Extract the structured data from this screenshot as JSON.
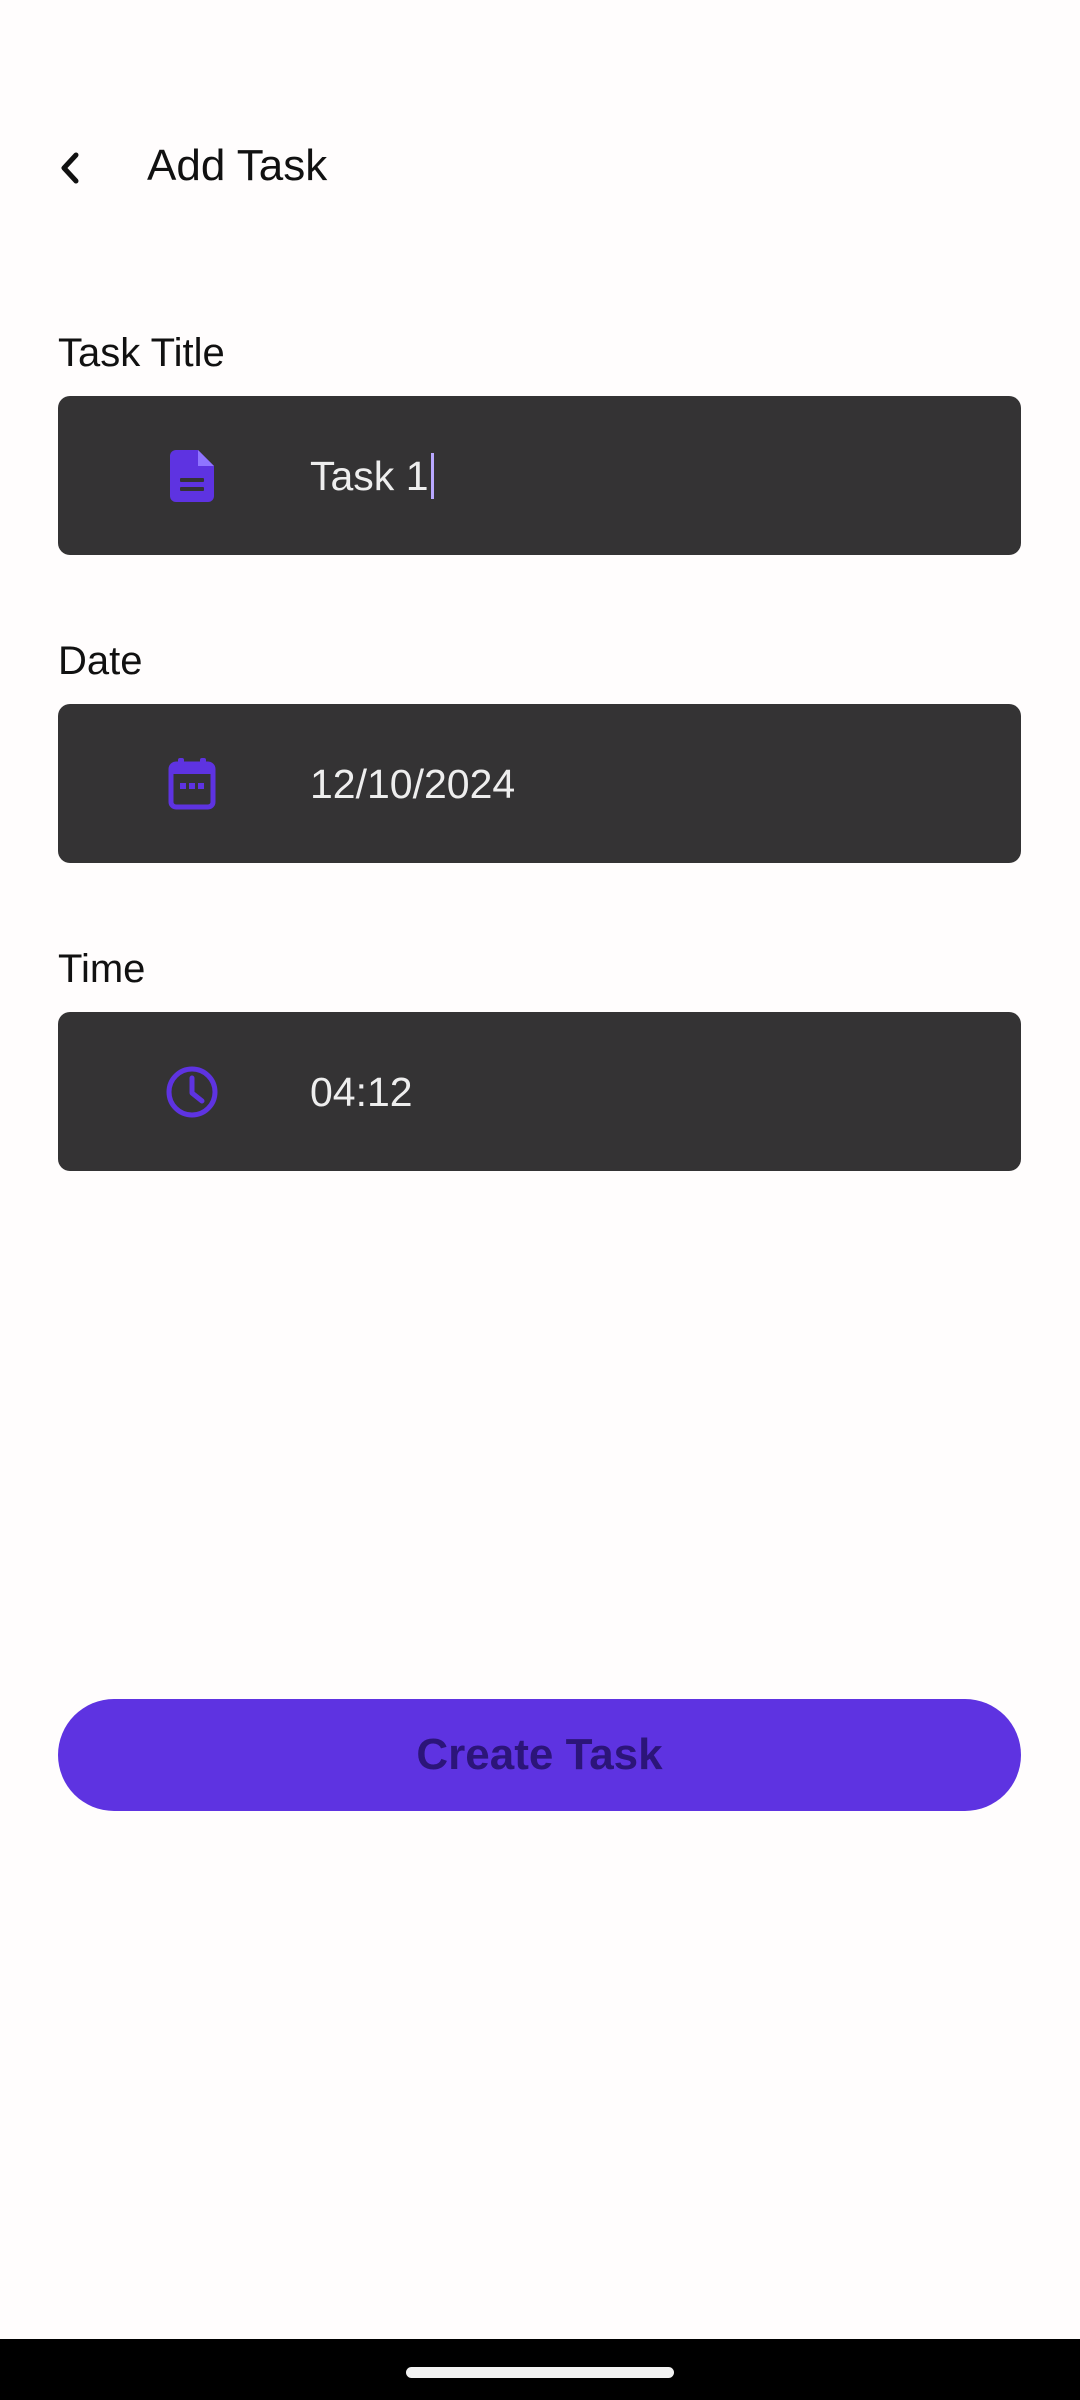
{
  "header": {
    "title": "Add Task",
    "back_icon": "chevron-left-icon"
  },
  "form": {
    "task_title": {
      "label": "Task Title",
      "value": "Task 1",
      "icon": "document-icon"
    },
    "date": {
      "label": "Date",
      "value": "12/10/2024",
      "icon": "calendar-icon"
    },
    "time": {
      "label": "Time",
      "value": "04:12",
      "icon": "clock-icon"
    }
  },
  "actions": {
    "create_label": "Create Task"
  },
  "colors": {
    "accent": "#5e33e1",
    "field_background": "#343334",
    "button_text": "#2c1579",
    "page_background": "#fffdfd"
  }
}
